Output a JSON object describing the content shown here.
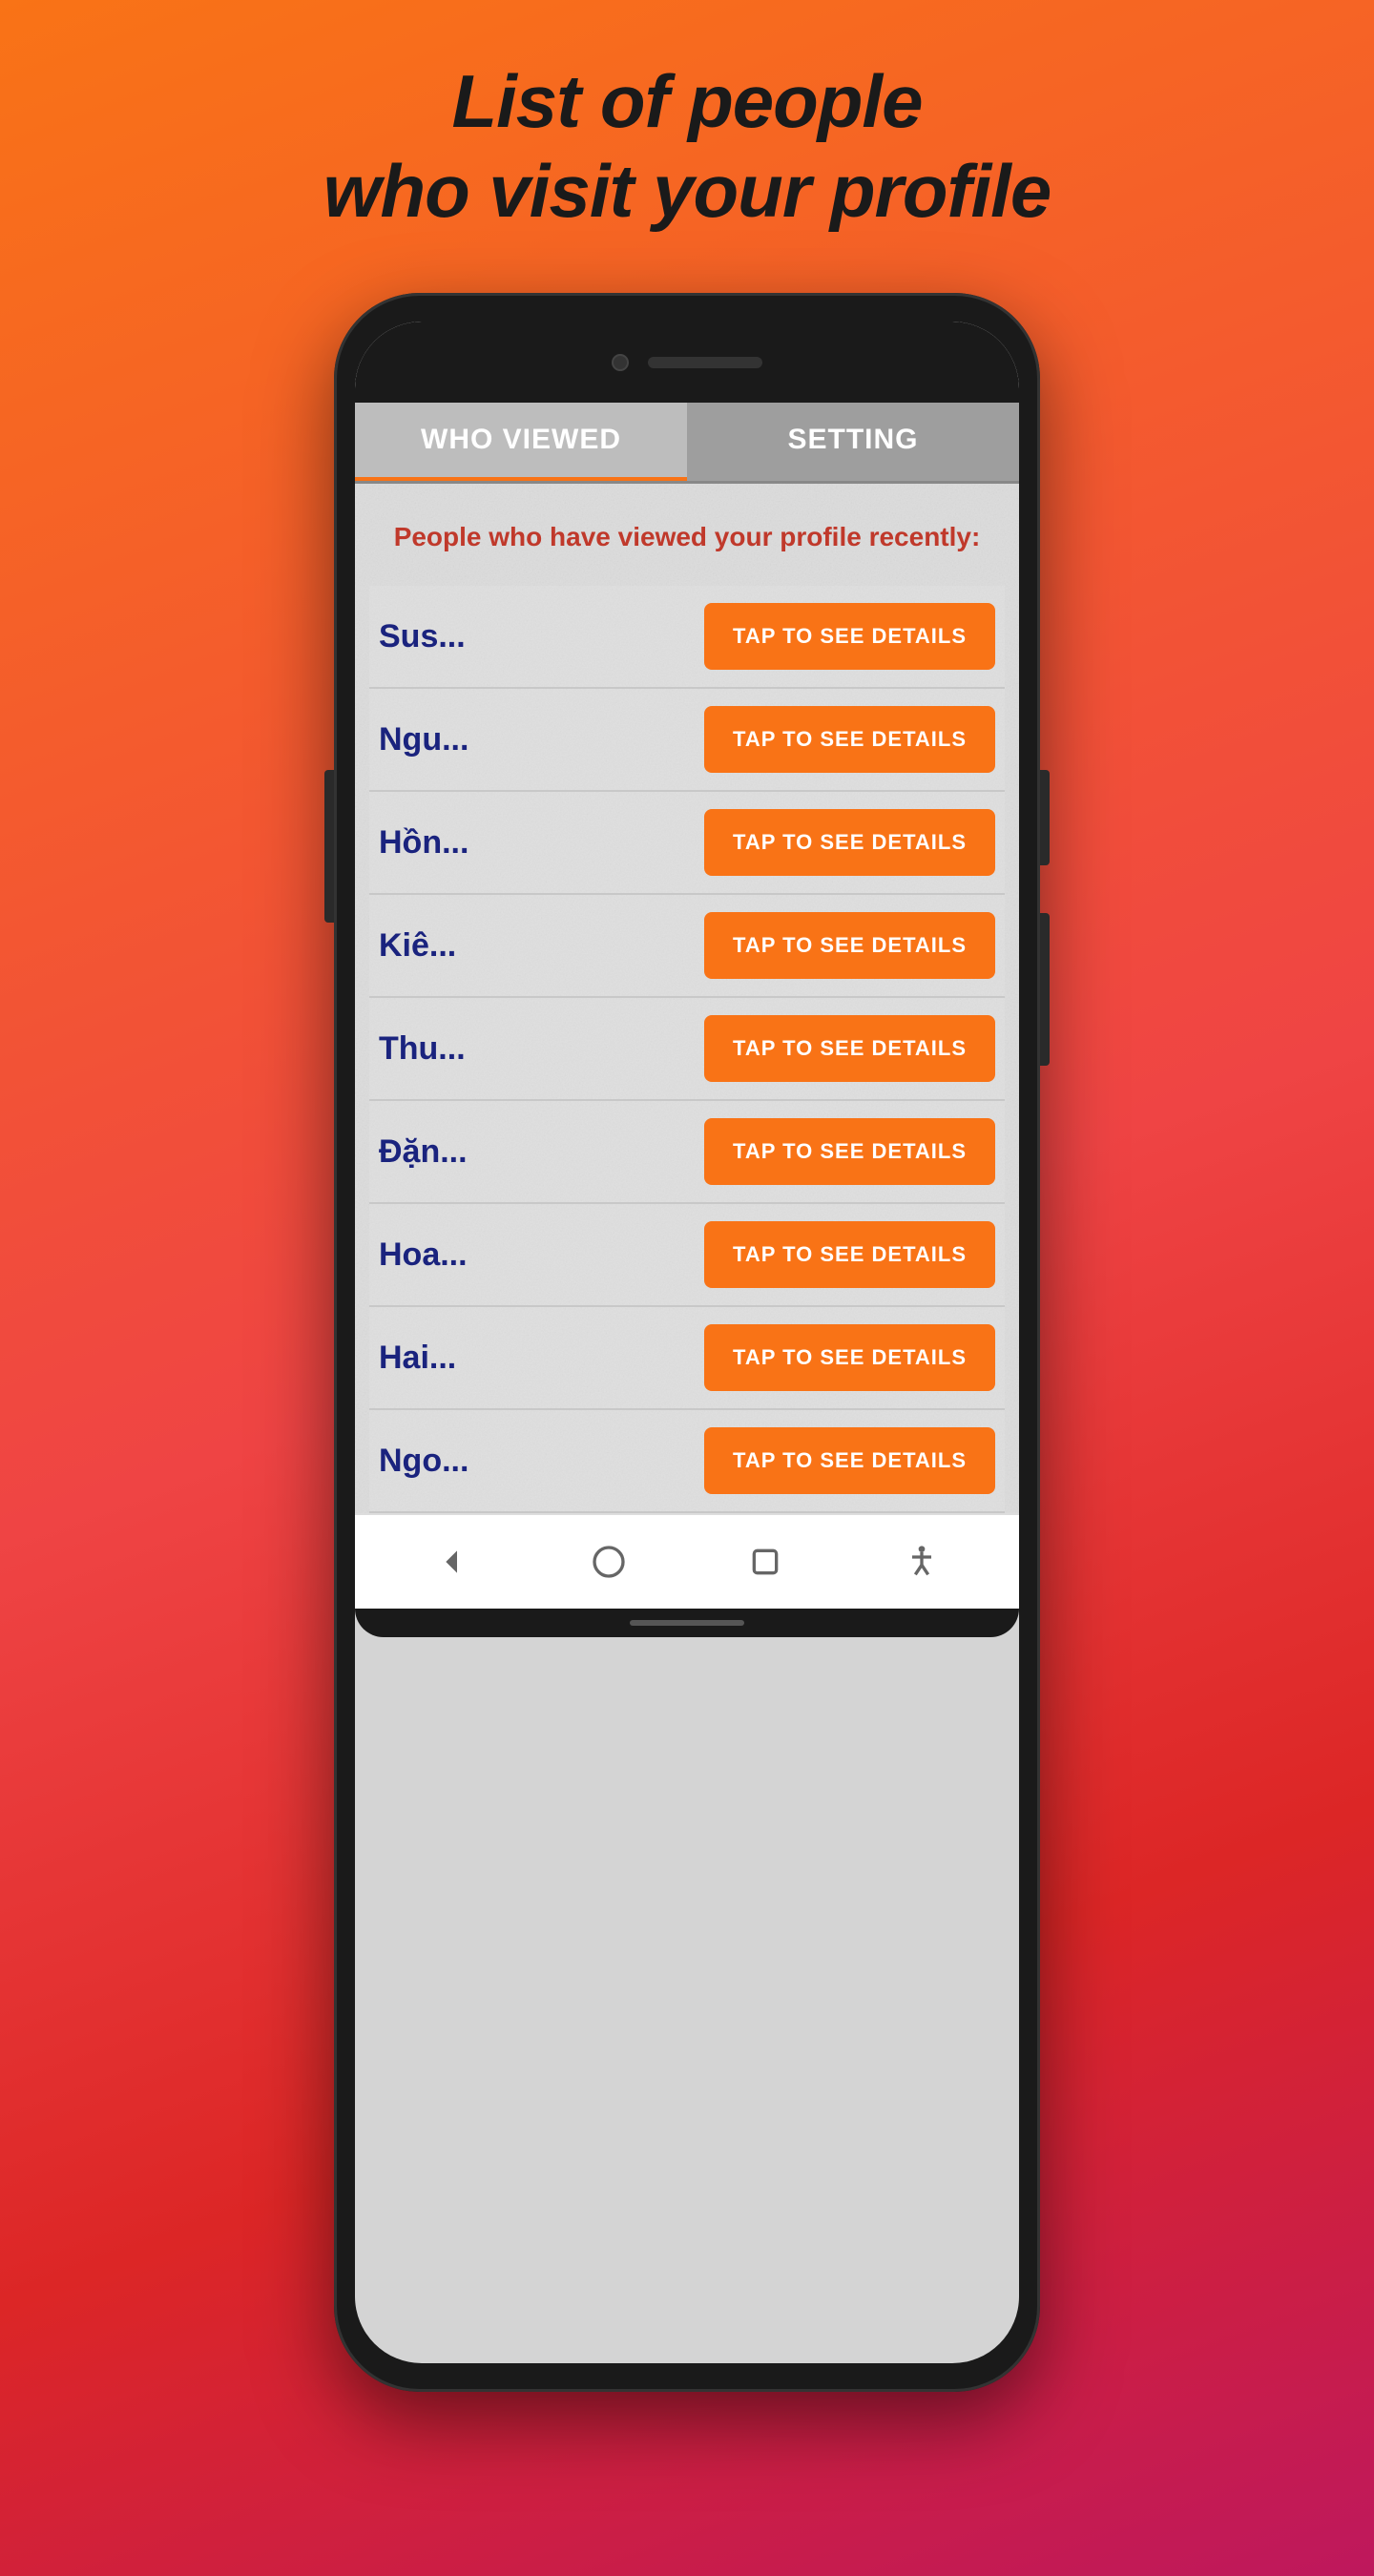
{
  "page": {
    "title_line1": "List of people",
    "title_line2": "who visit your profile"
  },
  "tabs": [
    {
      "id": "who-viewed",
      "label": "WHO VIEWED",
      "active": true
    },
    {
      "id": "setting",
      "label": "SETTING",
      "active": false
    }
  ],
  "subtitle": "People who have viewed your profile recently:",
  "people": [
    {
      "name": "Sus..."
    },
    {
      "name": "Ngu..."
    },
    {
      "name": "Hồn..."
    },
    {
      "name": "Kiê..."
    },
    {
      "name": "Thu..."
    },
    {
      "name": "Đặn..."
    },
    {
      "name": "Hoa..."
    },
    {
      "name": "Hai..."
    },
    {
      "name": "Ngo..."
    }
  ],
  "tap_button_label": "TAP TO SEE DETAILS",
  "nav": {
    "back": "back-icon",
    "home": "home-icon",
    "recent": "recent-icon",
    "accessibility": "accessibility-icon"
  }
}
